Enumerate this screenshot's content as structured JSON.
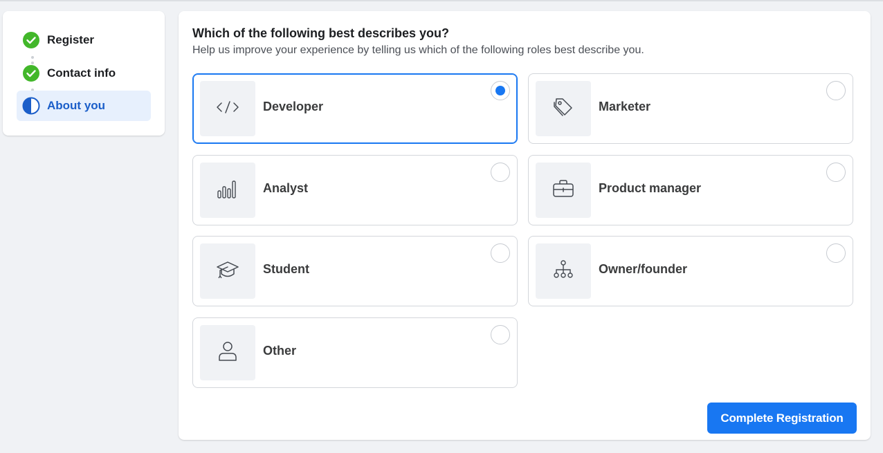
{
  "steps": [
    {
      "label": "Register",
      "status": "complete",
      "icon": "check-circle-icon"
    },
    {
      "label": "Contact info",
      "status": "complete",
      "icon": "check-circle-icon"
    },
    {
      "label": "About you",
      "status": "current",
      "icon": "half-circle-icon"
    }
  ],
  "question": {
    "title": "Which of the following best describes you?",
    "subtitle": "Help us improve your experience by telling us which of the following roles best describe you."
  },
  "options": [
    {
      "label": "Developer",
      "icon": "code-icon",
      "selected": true
    },
    {
      "label": "Marketer",
      "icon": "tag-icon",
      "selected": false
    },
    {
      "label": "Analyst",
      "icon": "bar-chart-icon",
      "selected": false
    },
    {
      "label": "Product manager",
      "icon": "briefcase-icon",
      "selected": false
    },
    {
      "label": "Student",
      "icon": "graduation-cap-icon",
      "selected": false
    },
    {
      "label": "Owner/founder",
      "icon": "org-chart-icon",
      "selected": false
    },
    {
      "label": "Other",
      "icon": "person-icon",
      "selected": false
    }
  ],
  "actions": {
    "complete_label": "Complete Registration"
  },
  "colors": {
    "accent": "#1877f2",
    "success": "#42b72a",
    "active_step_bg": "#e7f0fd",
    "active_step_text": "#1b5ec9"
  }
}
